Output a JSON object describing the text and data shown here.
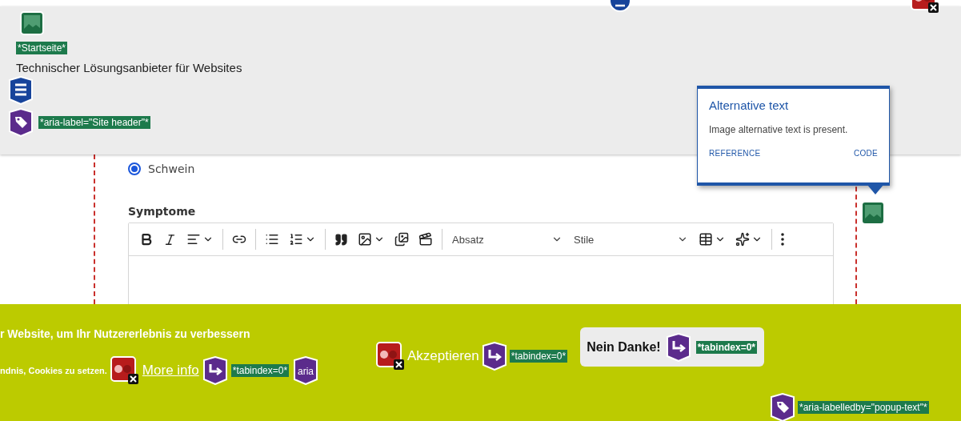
{
  "header": {
    "home_label": "*Startseite*",
    "tagline": "Technischer Lösungsanbieter für Websites",
    "aria_label": "*aria-label=\"Site header\"*"
  },
  "form": {
    "radio": {
      "label": "Schwein",
      "selected": true
    },
    "field_label": "Symptome",
    "toolbar": {
      "heading_select": "Absatz",
      "style_select": "Stile"
    }
  },
  "tooltip": {
    "title": "Alternative text",
    "message": "Image alternative text is present.",
    "links": [
      "REFERENCE",
      "CODE"
    ]
  },
  "cookie_banner": {
    "text_line_1": "r Website, um Ihr Nutzererlebnis zu verbessern",
    "text_line_2": "ndnis, Cookies zu setzen.",
    "more_info": {
      "label": "More info",
      "tabindex_label": "*tabindex=0*",
      "aria_badge": "aria"
    },
    "accept": {
      "label": "Akzeptieren",
      "tabindex_label": "*tabindex=0*"
    },
    "decline": {
      "label": "Nein Danke!",
      "tabindex_label": "*tabindex=0*"
    },
    "labelledby_label": "*aria-labelledby=\"popup-text\"*"
  }
}
